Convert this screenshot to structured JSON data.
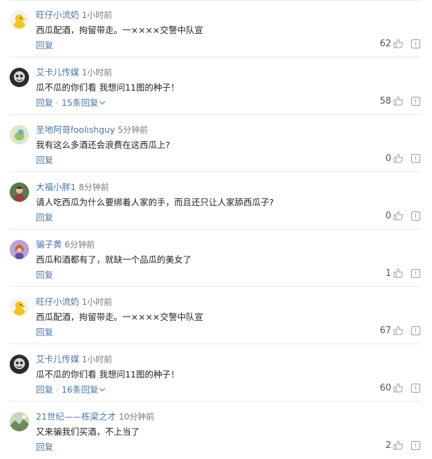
{
  "comments": [
    {
      "author": "旺仔小流奶",
      "time": "1小时前",
      "text": "西瓜配酒，拘留带走。一××××交警中队宣",
      "reply_label": "回复",
      "replies_label": "",
      "likes": "62",
      "avatar": "duck-avatar"
    },
    {
      "author": "艾卡儿传媒",
      "time": "1小时前",
      "text": "瓜不瓜的你们看 我想问11图的种子！",
      "reply_label": "回复",
      "replies_label": "15条回复",
      "likes": "58",
      "avatar": "mask-avatar"
    },
    {
      "author": "圣地阿哥foolishguy",
      "time": "5分钟前",
      "text": "我有这么多酒还会浪费在这西瓜上?",
      "reply_label": "回复",
      "replies_label": "",
      "likes": "0",
      "avatar": "bird-avatar"
    },
    {
      "author": "大福小胖1",
      "time": "8分钟前",
      "text": "请人吃西瓜为什么要绑着人家的手，而且还只让人家舔西瓜子?",
      "reply_label": "回复",
      "replies_label": "",
      "likes": "0",
      "avatar": "person-avatar"
    },
    {
      "author": "骗子黄",
      "time": "6分钟前",
      "text": "西瓜和酒都有了，就缺一个品瓜的美女了",
      "reply_label": "回复",
      "replies_label": "",
      "likes": "1",
      "avatar": "girl-avatar"
    },
    {
      "author": "旺仔小流奶",
      "time": "1小时前",
      "text": "西瓜配酒，拘留带走。一××××交警中队宣",
      "reply_label": "回复",
      "replies_label": "",
      "likes": "67",
      "avatar": "duck-avatar"
    },
    {
      "author": "艾卡儿传媒",
      "time": "1小时前",
      "text": "瓜不瓜的你们看 我想问11图的种子！",
      "reply_label": "回复",
      "replies_label": "16条回复",
      "likes": "60",
      "avatar": "mask-avatar"
    },
    {
      "author": "21世纪——栋梁之才",
      "time": "10分钟前",
      "text": "又来骗我们买酒，不上当了",
      "reply_label": "回复",
      "replies_label": "",
      "likes": "2",
      "avatar": "landscape-avatar"
    }
  ],
  "colors": {
    "link": "#4a74a8",
    "text": "#222222",
    "meta": "#7a7a7a",
    "divider": "#e8e8e8"
  }
}
